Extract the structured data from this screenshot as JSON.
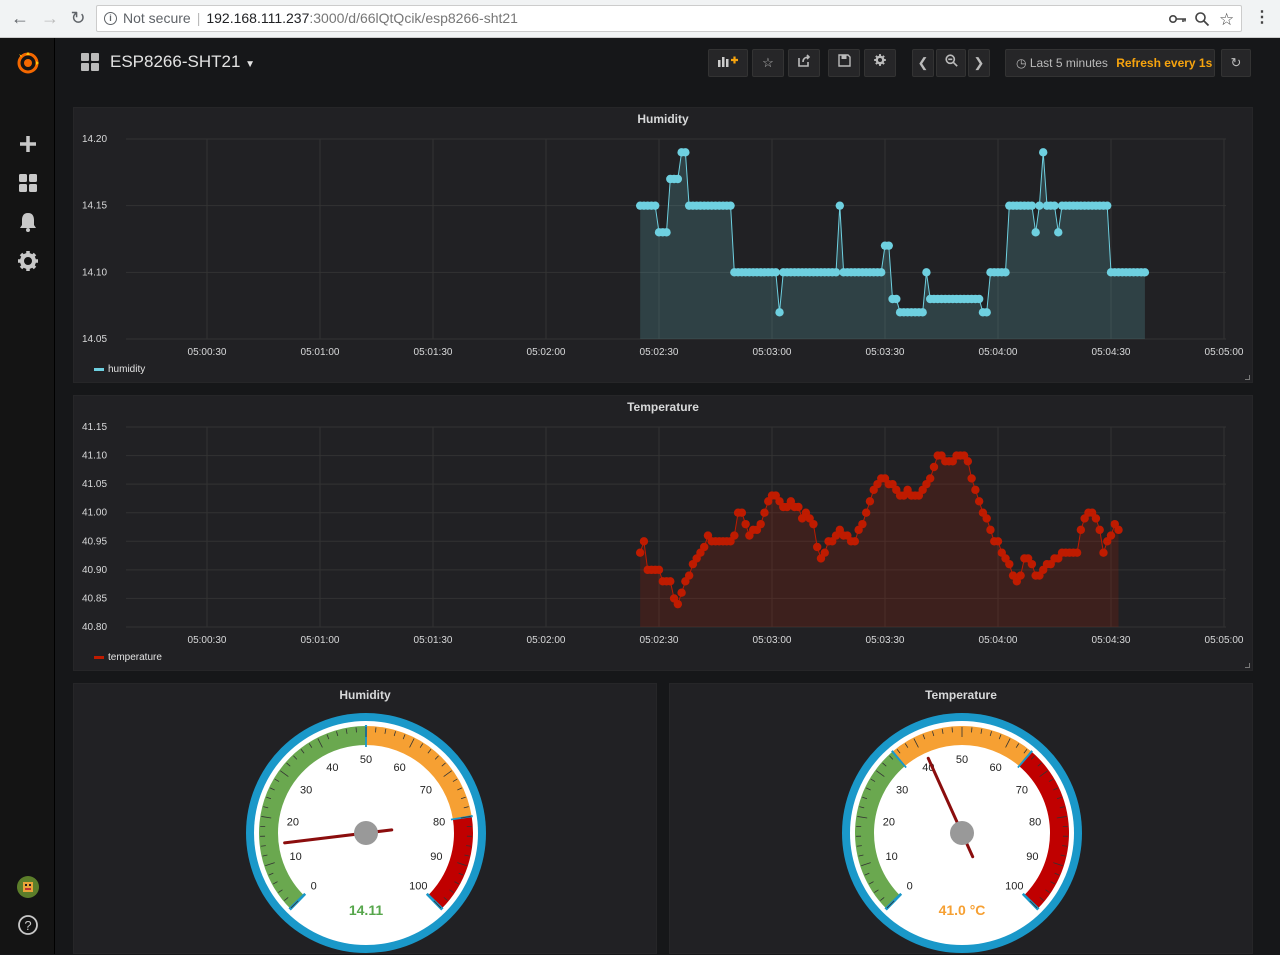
{
  "browser": {
    "security": "Not secure",
    "host": "192.168.111.237",
    "path": ":3000/d/66lQtQcik/esp8266-sht21"
  },
  "dashboard": {
    "title": "ESP8266-SHT21",
    "time_range": "Last 5 minutes",
    "refresh": "Refresh every 1s"
  },
  "colors": {
    "humidity": "#6ed0e0",
    "temperature": "#bf1b00",
    "refresh": "#f7a40e"
  },
  "chart_data": [
    {
      "type": "line",
      "title": "Humidity",
      "series": [
        {
          "name": "humidity",
          "color": "#6ed0e0"
        }
      ],
      "x_ticks": [
        "05:00:30",
        "05:01:00",
        "05:01:30",
        "05:02:00",
        "05:02:30",
        "05:03:00",
        "05:03:30",
        "05:04:00",
        "05:04:30",
        "05:05:00"
      ],
      "y_ticks": [
        "14.20",
        "14.15",
        "14.10",
        "14.05"
      ],
      "ylim": [
        14.05,
        14.2
      ],
      "x_start": "05:02:25",
      "x_step_seconds": 1,
      "values": [
        14.15,
        14.15,
        14.15,
        14.15,
        14.15,
        14.13,
        14.13,
        14.13,
        14.17,
        14.17,
        14.17,
        14.19,
        14.19,
        14.15,
        14.15,
        14.15,
        14.15,
        14.15,
        14.15,
        14.15,
        14.15,
        14.15,
        14.15,
        14.15,
        14.15,
        14.1,
        14.1,
        14.1,
        14.1,
        14.1,
        14.1,
        14.1,
        14.1,
        14.1,
        14.1,
        14.1,
        14.1,
        14.07,
        14.1,
        14.1,
        14.1,
        14.1,
        14.1,
        14.1,
        14.1,
        14.1,
        14.1,
        14.1,
        14.1,
        14.1,
        14.1,
        14.1,
        14.1,
        14.15,
        14.1,
        14.1,
        14.1,
        14.1,
        14.1,
        14.1,
        14.1,
        14.1,
        14.1,
        14.1,
        14.1,
        14.12,
        14.12,
        14.08,
        14.08,
        14.07,
        14.07,
        14.07,
        14.07,
        14.07,
        14.07,
        14.07,
        14.1,
        14.08,
        14.08,
        14.08,
        14.08,
        14.08,
        14.08,
        14.08,
        14.08,
        14.08,
        14.08,
        14.08,
        14.08,
        14.08,
        14.08,
        14.07,
        14.07,
        14.1,
        14.1,
        14.1,
        14.1,
        14.1,
        14.15,
        14.15,
        14.15,
        14.15,
        14.15,
        14.15,
        14.15,
        14.13,
        14.15,
        14.19,
        14.15,
        14.15,
        14.15,
        14.13,
        14.15,
        14.15,
        14.15,
        14.15,
        14.15,
        14.15,
        14.15,
        14.15,
        14.15,
        14.15,
        14.15,
        14.15,
        14.15,
        14.1,
        14.1,
        14.1,
        14.1,
        14.1,
        14.1,
        14.1,
        14.1,
        14.1,
        14.1
      ]
    },
    {
      "type": "line",
      "title": "Temperature",
      "series": [
        {
          "name": "temperature",
          "color": "#bf1b00"
        }
      ],
      "x_ticks": [
        "05:00:30",
        "05:01:00",
        "05:01:30",
        "05:02:00",
        "05:02:30",
        "05:03:00",
        "05:03:30",
        "05:04:00",
        "05:04:30",
        "05:05:00"
      ],
      "y_ticks": [
        "41.15",
        "41.10",
        "41.05",
        "41.00",
        "40.95",
        "40.90",
        "40.85",
        "40.80"
      ],
      "ylim": [
        40.8,
        41.15
      ],
      "x_start": "05:02:25",
      "x_step_seconds": 1,
      "values": [
        40.93,
        40.95,
        40.9,
        40.9,
        40.9,
        40.9,
        40.88,
        40.88,
        40.88,
        40.85,
        40.84,
        40.86,
        40.88,
        40.89,
        40.91,
        40.92,
        40.93,
        40.94,
        40.96,
        40.95,
        40.95,
        40.95,
        40.95,
        40.95,
        40.95,
        40.96,
        41.0,
        41.0,
        40.98,
        40.96,
        40.97,
        40.97,
        40.98,
        41.0,
        41.02,
        41.03,
        41.03,
        41.02,
        41.01,
        41.01,
        41.02,
        41.01,
        41.01,
        40.99,
        41.0,
        40.99,
        40.98,
        40.94,
        40.92,
        40.93,
        40.95,
        40.95,
        40.96,
        40.97,
        40.96,
        40.96,
        40.95,
        40.95,
        40.97,
        40.98,
        41.0,
        41.02,
        41.04,
        41.05,
        41.06,
        41.06,
        41.05,
        41.05,
        41.04,
        41.03,
        41.03,
        41.04,
        41.03,
        41.03,
        41.03,
        41.04,
        41.05,
        41.06,
        41.08,
        41.1,
        41.1,
        41.09,
        41.09,
        41.09,
        41.1,
        41.1,
        41.1,
        41.09,
        41.06,
        41.04,
        41.02,
        41.0,
        40.99,
        40.97,
        40.95,
        40.95,
        40.93,
        40.92,
        40.91,
        40.89,
        40.88,
        40.89,
        40.92,
        40.92,
        40.91,
        40.89,
        40.89,
        40.9,
        40.91,
        40.91,
        40.92,
        40.92,
        40.93,
        40.93,
        40.93,
        40.93,
        40.93,
        40.97,
        40.99,
        41.0,
        41.0,
        40.99,
        40.97,
        40.93,
        40.95,
        40.96,
        40.98,
        40.97
      ]
    }
  ],
  "gauges": [
    {
      "title": "Humidity",
      "value": 14.11,
      "display": "14.11",
      "value_color": "#56a64b",
      "ticks": [
        "0",
        "10",
        "20",
        "30",
        "40",
        "50",
        "60",
        "70",
        "80",
        "90",
        "100"
      ],
      "bands": [
        {
          "from": 0,
          "to": 50,
          "color": "#6aa84f"
        },
        {
          "from": 50,
          "to": 80,
          "color": "#f6a033"
        },
        {
          "from": 80,
          "to": 100,
          "color": "#c00000"
        }
      ]
    },
    {
      "title": "Temperature",
      "value": 41.0,
      "display": "41.0 °C",
      "value_color": "#f6a033",
      "ticks": [
        "0",
        "10",
        "20",
        "30",
        "40",
        "50",
        "60",
        "70",
        "80",
        "90",
        "100"
      ],
      "bands": [
        {
          "from": 0,
          "to": 35,
          "color": "#6aa84f"
        },
        {
          "from": 35,
          "to": 65,
          "color": "#f6a033"
        },
        {
          "from": 65,
          "to": 100,
          "color": "#c00000"
        }
      ]
    }
  ]
}
